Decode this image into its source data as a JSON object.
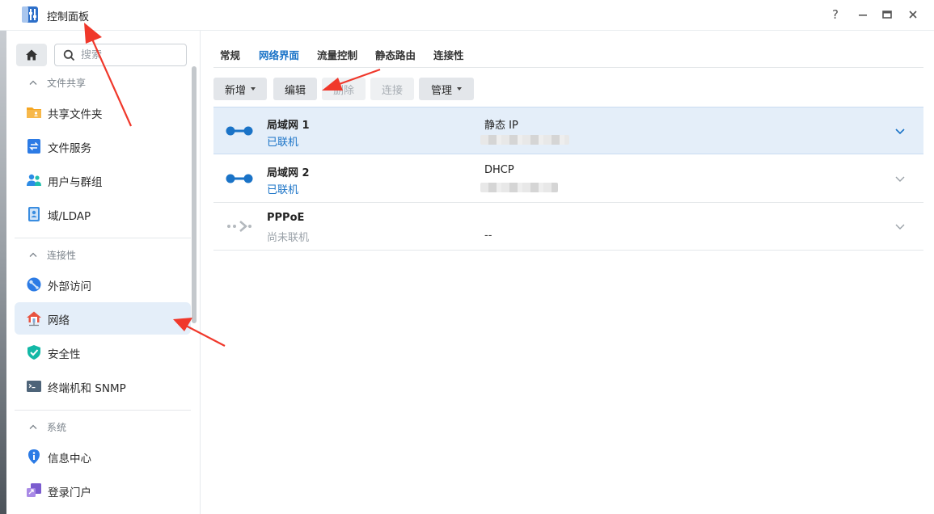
{
  "window": {
    "title": "控制面板",
    "help_label": "?",
    "minimize_label": "—",
    "maximize_label": "▭",
    "close_label": "✕"
  },
  "sidebar": {
    "search_placeholder": "搜索",
    "sections": {
      "file_sharing": "文件共享",
      "connectivity": "连接性",
      "system": "系统"
    },
    "items": {
      "shared_folder": "共享文件夹",
      "file_services": "文件服务",
      "users_groups": "用户与群组",
      "domain_ldap": "域/LDAP",
      "external_access": "外部访问",
      "network": "网络",
      "security": "安全性",
      "terminal_snmp": "终端机和 SNMP",
      "info_center": "信息中心",
      "login_portal": "登录门户"
    },
    "active_item": "network"
  },
  "tabs": {
    "general": "常规",
    "network_interface": "网络界面",
    "traffic_control": "流量控制",
    "static_route": "静态路由",
    "connectivity": "连接性"
  },
  "active_tab": "network_interface",
  "toolbar": {
    "create": "新增",
    "edit": "编辑",
    "delete": "删除",
    "connect": "连接",
    "manage": "管理"
  },
  "interfaces": [
    {
      "name": "局域网 1",
      "status": "已联机",
      "type": "静态 IP",
      "ip": "",
      "selected": true
    },
    {
      "name": "局域网 2",
      "status": "已联机",
      "type": "DHCP",
      "ip": "",
      "selected": false
    },
    {
      "name": "PPPoE",
      "status": "尚未联机",
      "type": "",
      "ip": "--",
      "selected": false
    }
  ],
  "colors": {
    "accent": "#1a73c7",
    "selected_row": "#e4eef9",
    "annotation_arrow": "#f0382b"
  }
}
